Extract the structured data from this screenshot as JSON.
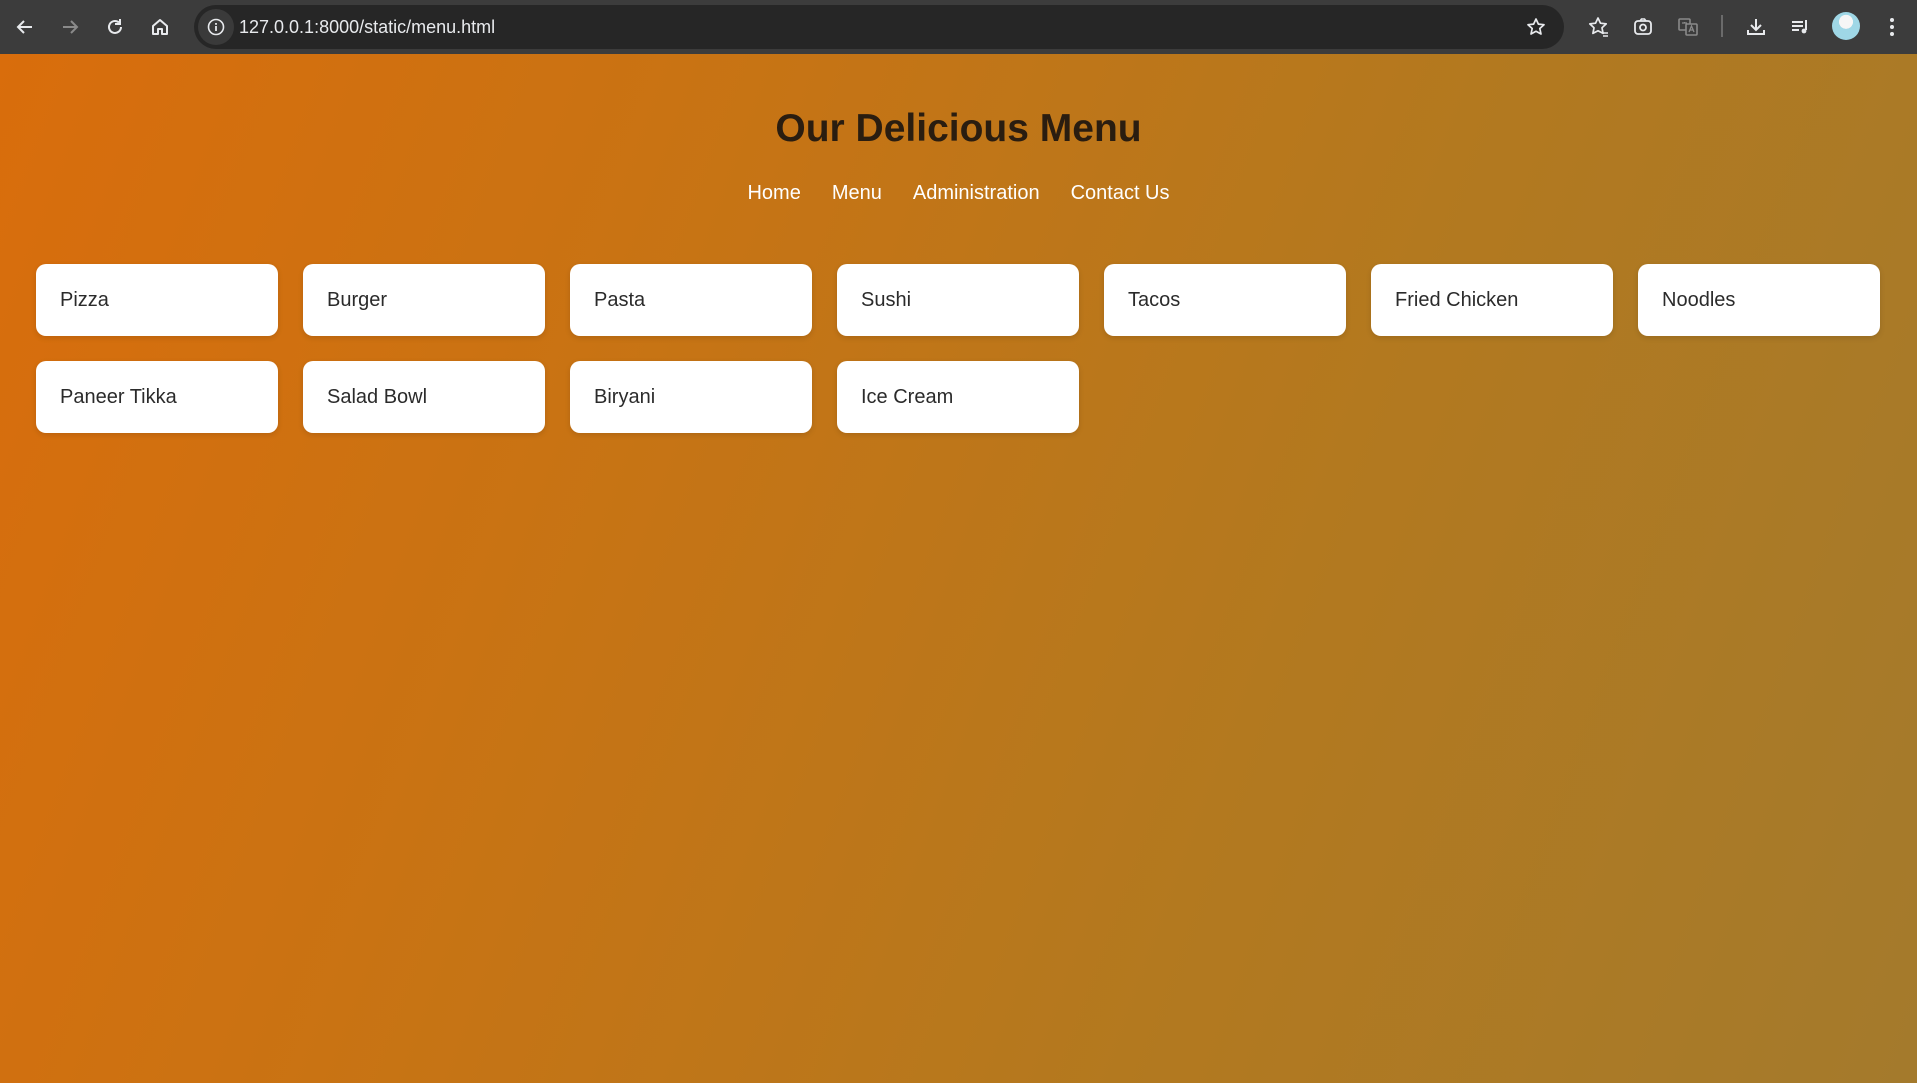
{
  "browser": {
    "url": "127.0.0.1:8000/static/menu.html",
    "icons": {
      "back": "back-arrow-icon",
      "forward": "forward-arrow-icon",
      "reload": "reload-icon",
      "home": "home-icon",
      "site_info": "info-icon",
      "bookmark": "star-icon",
      "bookmarks_manager": "star-list-icon",
      "lens": "camera-search-icon",
      "translate": "translate-icon",
      "downloads": "download-icon",
      "reading_list": "reading-list-icon",
      "profile": "avatar",
      "menu": "kebab-menu-icon"
    }
  },
  "page": {
    "title": "Our Delicious Menu",
    "nav": [
      "Home",
      "Menu",
      "Administration",
      "Contact Us"
    ],
    "menu_items": [
      "Pizza",
      "Burger",
      "Pasta",
      "Sushi",
      "Tacos",
      "Fried Chicken",
      "Noodles",
      "Paneer Tikka",
      "Salad Bowl",
      "Biryani",
      "Ice Cream"
    ],
    "colors": {
      "gradient_start": "#d96d0c",
      "gradient_end": "#a47a2c",
      "title": "#2a1d10",
      "nav_text": "#ffffff",
      "card_bg": "#ffffff"
    }
  }
}
